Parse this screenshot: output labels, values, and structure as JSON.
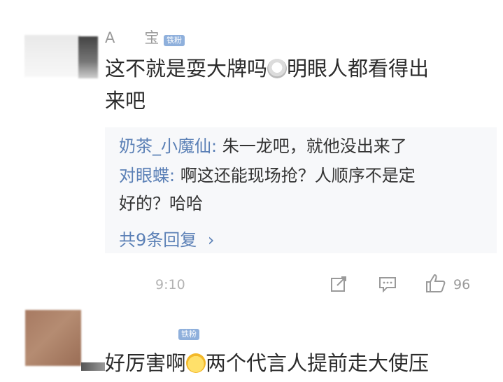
{
  "comment1": {
    "username": "A  宝",
    "badge": "铁粉",
    "text_line1_a": "这不就是耍大牌吗",
    "text_line1_b": "明眼人都看得出",
    "text_line2": "来吧",
    "time": "9:10",
    "like_count": "96"
  },
  "replies": [
    {
      "name": "奶茶_小魔仙:",
      "text": " 朱一龙吧，就他没出来了"
    },
    {
      "name": "对眼蝶:",
      "text": " 啊这还能现场抢？人顺序不是定"
    }
  ],
  "reply_continuation": "好的？哈哈",
  "more_replies": "共9条回复",
  "comment2": {
    "badge": "铁粉",
    "text_a": "好厉害啊",
    "text_b": "两个代言人提前走大使压"
  },
  "icons": {
    "share": "share-icon",
    "comment": "comment-icon",
    "like": "thumbs-up-icon",
    "chevron": "chevron-right-icon"
  },
  "colors": {
    "link_blue": "#5b80b6",
    "badge_blue": "#8fb0dc",
    "muted": "#9a9a9a"
  }
}
